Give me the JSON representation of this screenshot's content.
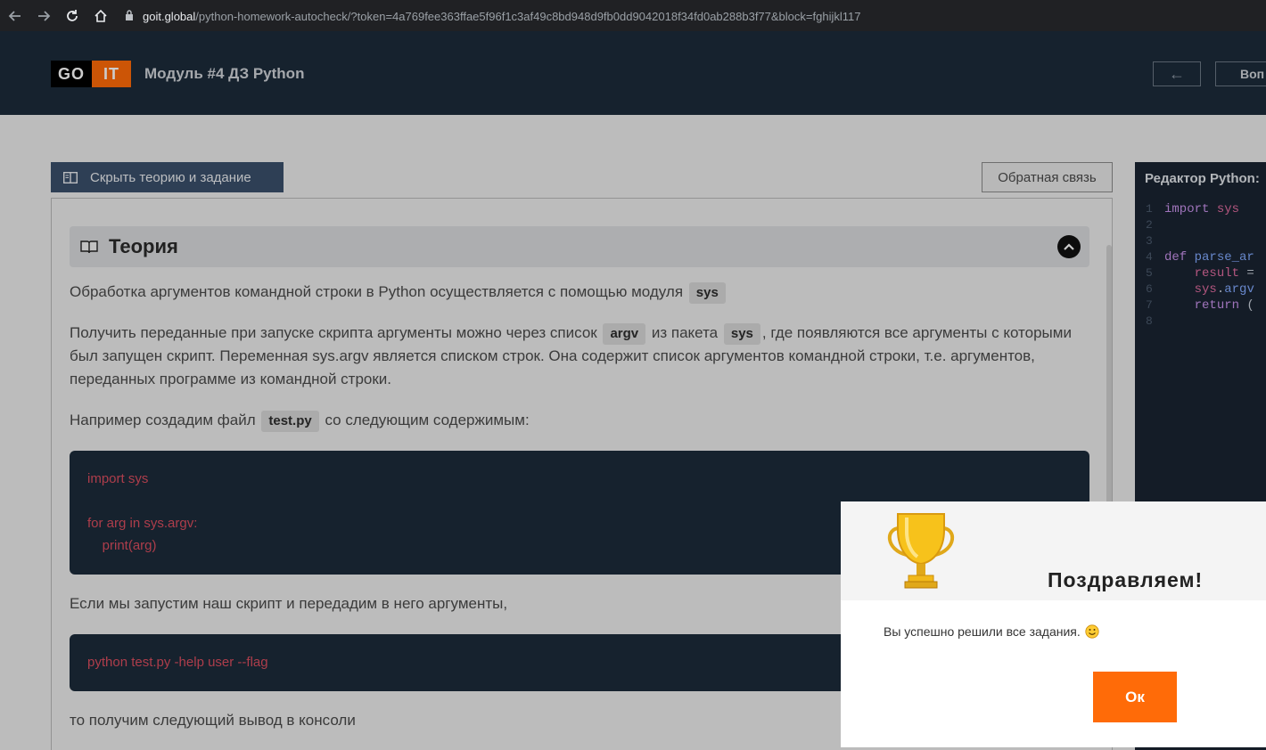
{
  "browser": {
    "url_domain": "goit.global",
    "url_rest": "/python-homework-autocheck/?token=4a769fee363ffae5f96f1c3af49c8bd948d9fb0dd9042018f34fd0ab288b3f77&block=fghijkl117"
  },
  "header": {
    "logo_left": "GO",
    "logo_right": "IT",
    "module_title": "Модуль #4 ДЗ Python",
    "back_icon": "←",
    "questions_label": "Воп"
  },
  "theory_panel": {
    "toggle_label": "Скрыть теорию и задание",
    "feedback_label": "Обратная связь",
    "section_title": "Теория",
    "p1_text": "Обработка аргументов командной строки в Python осуществляется с помощью модуля",
    "p1_code": "sys",
    "p2_text_a": "Получить переданные при запуске скрипта аргументы можно через список",
    "p2_code_a": "argv",
    "p2_text_b": "из пакета",
    "p2_code_b": "sys",
    "p2_text_c": ", где появляются все аргументы с которыми был запущен скрипт. Переменная sys.argv является списком строк. Она содержит список аргументов командной строки, т.е. аргументов, переданных программе из командной строки.",
    "p3_text_a": "Например создадим файл",
    "p3_code": "test.py",
    "p3_text_b": "со следующим содержимым:",
    "code1": [
      "import sys",
      "",
      "for arg in sys.argv:",
      "    print(arg)"
    ],
    "p4_text": "Если мы запустим наш скрипт и передадим в него аргументы,",
    "code2": [
      "python test.py -help user --flag"
    ],
    "p5_text": "то получим следующий вывод в консоли"
  },
  "editor": {
    "title": "Редактор Python:",
    "line_numbers": [
      "1",
      "2",
      "3",
      "4",
      "5",
      "6",
      "7",
      "8"
    ]
  },
  "modal": {
    "title": "Поздравляем!",
    "message": "Вы успешно решили все задания.",
    "ok_label": "Ок"
  },
  "colors": {
    "accent": "#ff6b08",
    "header_bg": "#1c2b3a",
    "code_text": "#d94d5e"
  }
}
